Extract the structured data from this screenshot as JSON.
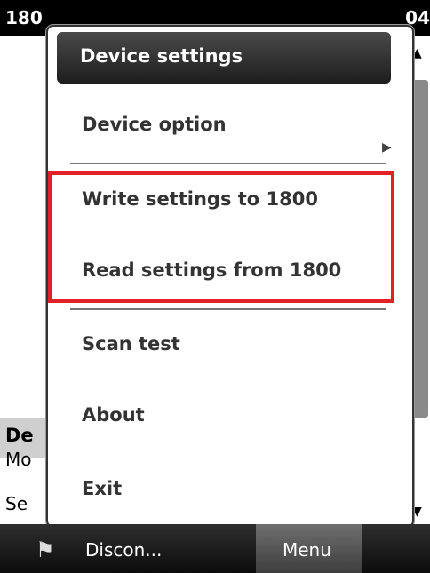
{
  "status_bar": {
    "left_text": "180",
    "right_text": "04"
  },
  "background": {
    "heading": "De",
    "rows": [
      "Mo",
      "Se"
    ]
  },
  "menu": {
    "header": "Device settings",
    "items": [
      {
        "label": "Device option",
        "has_submenu": true
      },
      {
        "label": "Write settings to 1800"
      },
      {
        "label": "Read settings from 1800"
      },
      {
        "label": "Scan test"
      },
      {
        "label": "About"
      },
      {
        "label": "Exit"
      }
    ]
  },
  "taskbar": {
    "start_icon": "windows-flag-icon",
    "left_softkey": "Discon...",
    "right_softkey": "Menu"
  },
  "colors": {
    "highlight": "#e32028"
  }
}
